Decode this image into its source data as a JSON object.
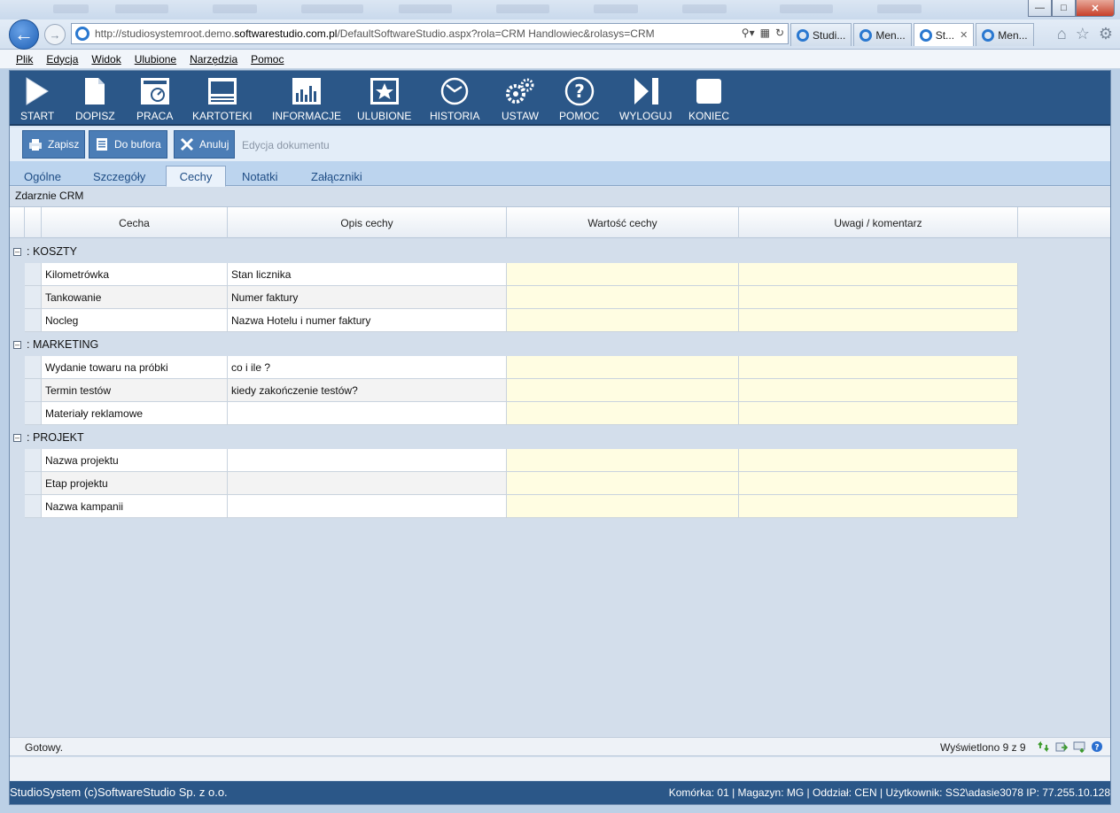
{
  "browser": {
    "url_prefix": "http://studiosystemroot.demo.",
    "url_domain": "softwarestudio.com.pl",
    "url_suffix": "/DefaultSoftwareStudio.aspx?rola=CRM Handlowiec&rolasys=CRM",
    "tabs": [
      {
        "label": "Studi..."
      },
      {
        "label": "Men..."
      },
      {
        "label": "St...",
        "close": "✕"
      },
      {
        "label": "Men..."
      }
    ],
    "menu": [
      "Plik",
      "Edycja",
      "Widok",
      "Ulubione",
      "Narzędzia",
      "Pomoc"
    ]
  },
  "toolbar": {
    "buttons": [
      {
        "label": "START",
        "icon": "play-icon"
      },
      {
        "label": "DOPISZ",
        "icon": "new-document-icon"
      },
      {
        "label": "PRACA",
        "icon": "dashboard-icon"
      },
      {
        "label": "KARTOTEKI",
        "icon": "cards-icon"
      },
      {
        "label": "INFORMACJE",
        "icon": "report-icon"
      },
      {
        "label": "ULUBIONE",
        "icon": "favorite-star-icon"
      },
      {
        "label": "HISTORIA",
        "icon": "history-icon"
      },
      {
        "label": "USTAW",
        "icon": "gears-icon"
      },
      {
        "label": "POMOC",
        "icon": "help-icon"
      },
      {
        "label": "WYLOGUJ",
        "icon": "logout-icon"
      },
      {
        "label": "KONIEC",
        "icon": "stop-icon"
      }
    ]
  },
  "actions": {
    "save": "Zapisz",
    "to_buffer": "Do bufora",
    "cancel": "Anuluj",
    "doc_label": "Edycja dokumentu"
  },
  "tabs": [
    {
      "label": "Ogólne"
    },
    {
      "label": "Szczegóły"
    },
    {
      "label": "Cechy",
      "active": true
    },
    {
      "label": "Notatki"
    },
    {
      "label": "Załączniki"
    }
  ],
  "panel": {
    "title": "Zdarznie CRM",
    "columns": [
      "Cecha",
      "Opis cechy",
      "Wartość cechy",
      "Uwagi / komentarz"
    ],
    "groups": [
      {
        "name": ": KOSZTY",
        "rows": [
          {
            "cecha": "Kilometrówka",
            "opis": "Stan licznika",
            "wartosc": "",
            "uwagi": ""
          },
          {
            "cecha": "Tankowanie",
            "opis": "Numer faktury",
            "wartosc": "",
            "uwagi": ""
          },
          {
            "cecha": "Nocleg",
            "opis": "Nazwa Hotelu i numer faktury",
            "wartosc": "",
            "uwagi": ""
          }
        ]
      },
      {
        "name": ": MARKETING",
        "rows": [
          {
            "cecha": "Wydanie towaru na próbki",
            "opis": "co i ile ?",
            "wartosc": "",
            "uwagi": ""
          },
          {
            "cecha": "Termin testów",
            "opis": "kiedy zakończenie testów?",
            "wartosc": "",
            "uwagi": ""
          },
          {
            "cecha": "Materiały reklamowe",
            "opis": "",
            "wartosc": "",
            "uwagi": ""
          }
        ]
      },
      {
        "name": ": PROJEKT",
        "rows": [
          {
            "cecha": "Nazwa projektu",
            "opis": "",
            "wartosc": "",
            "uwagi": ""
          },
          {
            "cecha": "Etap projektu",
            "opis": "",
            "wartosc": "",
            "uwagi": ""
          },
          {
            "cecha": "Nazwa kampanii",
            "opis": "",
            "wartosc": "",
            "uwagi": ""
          }
        ]
      }
    ]
  },
  "status": {
    "ready": "Gotowy.",
    "count": "Wyświetlono 9 z 9"
  },
  "footer": {
    "left": "StudioSystem (c)SoftwareStudio Sp. z o.o.",
    "right": "Komórka: 01 | Magazyn: MG | Oddział: CEN | Użytkownik: SS2\\adasie3078 IP: 77.255.10.128"
  }
}
